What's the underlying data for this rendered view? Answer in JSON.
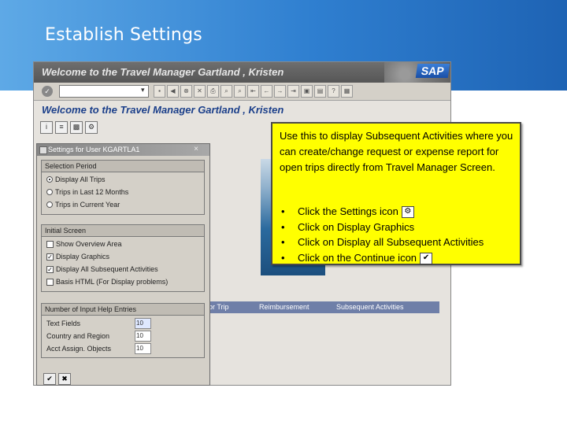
{
  "slide": {
    "title": "Establish Settings"
  },
  "sap": {
    "window_title": "Welcome to the Travel Manager Gartland , Kristen",
    "logo": "SAP",
    "main_title": "Welcome to the Travel Manager Gartland , Kristen",
    "grid_columns": [
      "or Trip",
      "Reimbursement",
      "Subsequent Activities"
    ]
  },
  "dialog": {
    "title": "Settings for User KGARTLA1",
    "close": "×",
    "selection_period": {
      "header": "Selection Period",
      "options": [
        "Display All Trips",
        "Trips in Last 12 Months",
        "Trips in Current Year"
      ],
      "selected_index": 0
    },
    "initial_screen": {
      "header": "Initial Screen",
      "items": [
        {
          "label": "Show Overview Area",
          "checked": false
        },
        {
          "label": "Display Graphics",
          "checked": true
        },
        {
          "label": "Display All Subsequent Activities",
          "checked": true
        },
        {
          "label": "Basis HTML (For Display problems)",
          "checked": false
        }
      ]
    },
    "input_help": {
      "header": "Number of Input Help Entries",
      "rows": [
        {
          "label": "Text Fields",
          "value": "10"
        },
        {
          "label": "Country and Region",
          "value": "10"
        },
        {
          "label": "Acct Assign. Objects",
          "value": "10"
        }
      ]
    },
    "buttons": {
      "continue": "✔",
      "cancel": "✖"
    }
  },
  "callout": {
    "intro": "Use this to display Subsequent Activities where you can create/change request or expense report for open trips directly from Travel Manager Screen.",
    "bullets": [
      "Click the Settings icon",
      "Click on Display Graphics",
      "Click on Display all Subsequent Activities",
      "Click on the Continue icon"
    ],
    "settings_icon": "settings-icon",
    "continue_icon": "continue-icon"
  }
}
